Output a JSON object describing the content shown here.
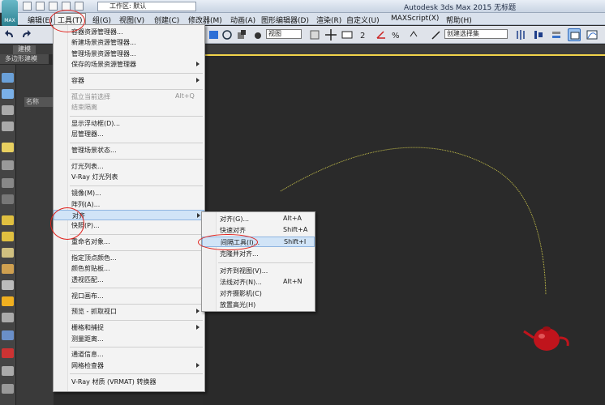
{
  "app": {
    "logo_text": "MAX",
    "workspace_label": "工作区: 默认",
    "window_title": "Autodesk 3ds Max  2015     无标题"
  },
  "menubar": [
    {
      "label": "编辑(E)"
    },
    {
      "label": "工具(T)",
      "active": true
    },
    {
      "label": "组(G)"
    },
    {
      "label": "视图(V)"
    },
    {
      "label": "创建(C)"
    },
    {
      "label": "修改器(M)"
    },
    {
      "label": "动画(A)"
    },
    {
      "label": "图形编辑器(D)"
    },
    {
      "label": "渲染(R)"
    },
    {
      "label": "自定义(U)"
    },
    {
      "label": "MAXScript(X)"
    },
    {
      "label": "帮助(H)"
    }
  ],
  "toolbar": {
    "view_select": "视图",
    "selection_set_select": "创建选择集"
  },
  "ribbon": {
    "tab1": "建模",
    "sub": "多边形建模"
  },
  "scene_panel": {
    "name_header": "名称"
  },
  "tools_menu": {
    "items": [
      {
        "label": "容器资源管理器..."
      },
      {
        "label": "新建场景资源管理器..."
      },
      {
        "label": "管理场景资源管理器..."
      },
      {
        "label": "保存的场景资源管理器",
        "submenu": true
      },
      {
        "sep": true
      },
      {
        "label": "容器",
        "submenu": true
      },
      {
        "sep": true
      },
      {
        "label": "孤立当前选择",
        "shortcut": "Alt+Q",
        "disabled": true
      },
      {
        "label": "结束隔离",
        "disabled": true
      },
      {
        "sep": true
      },
      {
        "label": "显示浮动框(D)..."
      },
      {
        "label": "层管理器..."
      },
      {
        "sep": true
      },
      {
        "label": "管理场景状态..."
      },
      {
        "sep": true
      },
      {
        "label": "灯光列表..."
      },
      {
        "label": "V-Ray 灯光列表"
      },
      {
        "sep": true
      },
      {
        "label": "镜像(M)..."
      },
      {
        "label": "阵列(A)..."
      },
      {
        "label": "对齐",
        "submenu": true,
        "highlighted": true
      },
      {
        "label": "快照(P)..."
      },
      {
        "sep": true
      },
      {
        "label": "重命名对象..."
      },
      {
        "sep": true
      },
      {
        "label": "指定顶点颜色..."
      },
      {
        "label": "颜色剪贴板..."
      },
      {
        "label": "透视匹配..."
      },
      {
        "sep": true
      },
      {
        "label": "视口画布..."
      },
      {
        "sep": true
      },
      {
        "label": "预览 - 抓取视口",
        "submenu": true
      },
      {
        "sep": true
      },
      {
        "label": "栅格和捕捉",
        "submenu": true
      },
      {
        "label": "测量距离..."
      },
      {
        "sep": true
      },
      {
        "label": "通道信息..."
      },
      {
        "label": "网格检查器",
        "submenu": true
      },
      {
        "sep": true
      },
      {
        "label": "V-Ray 材质 (VRMAT) 转换器"
      }
    ]
  },
  "align_submenu": {
    "items": [
      {
        "label": "对齐(G)...",
        "shortcut": "Alt+A"
      },
      {
        "label": "快速对齐",
        "shortcut": "Shift+A"
      },
      {
        "label": "间隔工具(I)...",
        "shortcut": "Shift+I",
        "highlighted": true
      },
      {
        "label": "克隆并对齐..."
      },
      {
        "sep": true
      },
      {
        "label": "对齐到视图(V)..."
      },
      {
        "label": "法线对齐(N)...",
        "shortcut": "Alt+N"
      },
      {
        "label": "对齐摄影机(C)"
      },
      {
        "label": "放置高光(H)"
      }
    ]
  },
  "colors": {
    "highlight_bg": "#d1e4f7",
    "annotation_red": "#e0201b",
    "viewport_border": "#f2d44a",
    "spline_color": "#c8c24a",
    "teapot_red": "#c0141c"
  }
}
